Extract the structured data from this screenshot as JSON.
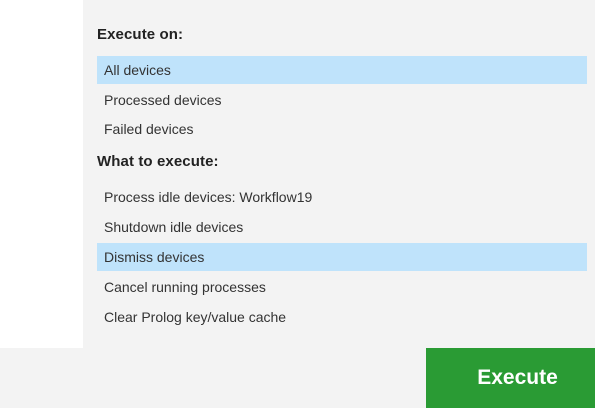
{
  "execute_on": {
    "heading": "Execute on:",
    "items": [
      {
        "label": "All devices",
        "selected": true
      },
      {
        "label": "Processed devices",
        "selected": false
      },
      {
        "label": "Failed devices",
        "selected": false
      }
    ]
  },
  "what_to_execute": {
    "heading": "What to execute:",
    "items": [
      {
        "label": "Process idle devices: Workflow19",
        "selected": false
      },
      {
        "label": "Shutdown idle devices",
        "selected": false
      },
      {
        "label": "Dismiss devices",
        "selected": true
      },
      {
        "label": "Cancel running processes",
        "selected": false
      },
      {
        "label": "Clear Prolog key/value cache",
        "selected": false
      }
    ]
  },
  "actions": {
    "execute_label": "Execute"
  },
  "colors": {
    "selection": "#bfe3fb",
    "execute_button": "#2a9b34",
    "panel_background": "#f3f3f3"
  }
}
